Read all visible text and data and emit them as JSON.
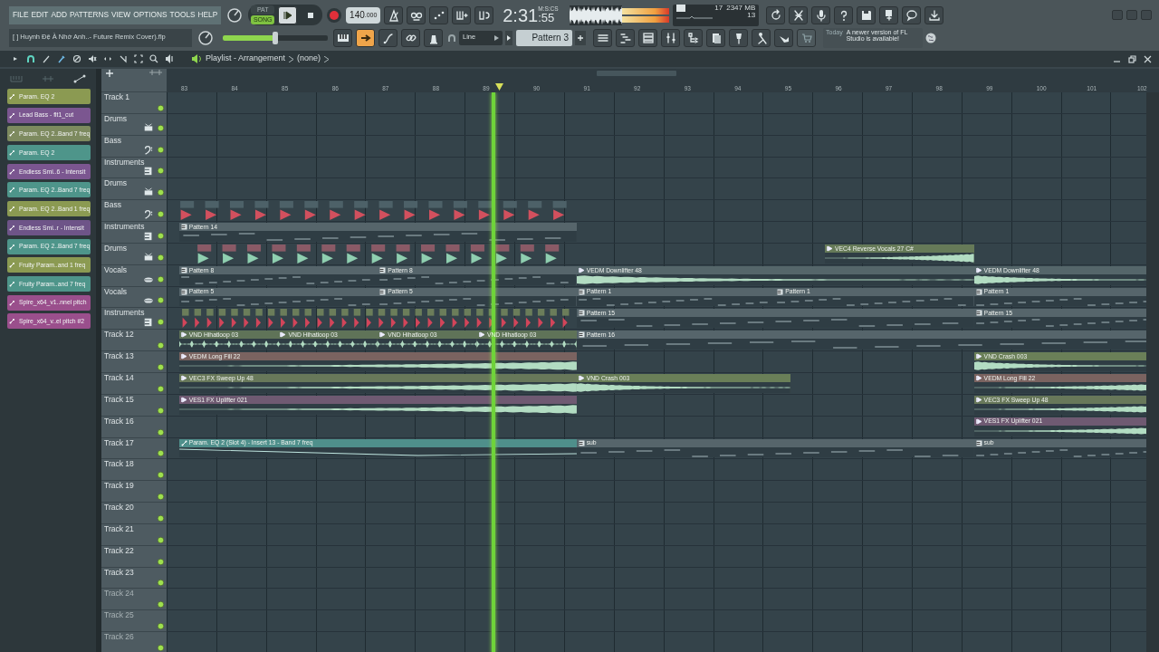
{
  "menu": [
    "FILE",
    "EDIT",
    "ADD",
    "PATTERNS",
    "VIEW",
    "OPTIONS",
    "TOOLS",
    "HELP"
  ],
  "file_name": "[    ] Huynh Đệ À Nhớ Anh..- Future Remix Cover).flp",
  "mode": [
    {
      "label": "PAT",
      "selected": false
    },
    {
      "label": "SONG",
      "selected": true
    }
  ],
  "tempo": {
    "whole": "140",
    "fraction": ".000"
  },
  "master_volume": {
    "level": 0.5
  },
  "time": {
    "value": "2:31",
    "centis": ":55",
    "units": "M:S:CS"
  },
  "cpu": {
    "value": "17"
  },
  "memory": {
    "value": "2347 MB"
  },
  "polyphony": {
    "value": "13"
  },
  "edit_tools": [
    {
      "selected": false
    },
    {
      "selected": true
    },
    {
      "selected": false
    },
    {
      "selected": false
    },
    {
      "selected": false
    }
  ],
  "snap": {
    "value": "Line"
  },
  "pattern": {
    "value": "Pattern 3"
  },
  "news": {
    "date": "Today",
    "message": "A newer version of FL Studio is available!"
  },
  "playlist": {
    "title": "Playlist - Arrangement",
    "context": "(none)"
  },
  "automation_clips": [
    {
      "label": "Param. EQ 2",
      "color": "#8b9a52"
    },
    {
      "label": "Lead Bass - flt1_cut",
      "color": "#7b5690"
    },
    {
      "label": "Param. EQ 2..Band 7 freq",
      "color": "#7d8a5f"
    },
    {
      "label": "Param. EQ 2",
      "color": "#4e958a"
    },
    {
      "label": "Endless Smi..6 - Intensit",
      "color": "#7b5690"
    },
    {
      "label": "Param. EQ 2..Band 7 freq",
      "color": "#4e958a"
    },
    {
      "label": "Param. EQ 2..Band 1 freq",
      "color": "#8b9a52"
    },
    {
      "label": "Endless Smi..r - Intensit",
      "color": "#6e5488"
    },
    {
      "label": "Param. EQ 2..Band 7 freq",
      "color": "#4e958a"
    },
    {
      "label": "Fruity Param..and 1 freq",
      "color": "#8b9a52"
    },
    {
      "label": "Fruity Param..and 7 freq",
      "color": "#4e958a"
    },
    {
      "label": "Spire_x64_v1..nnel pitch",
      "color": "#9a4f8c"
    },
    {
      "label": "Spire_x64_v..el pitch #2",
      "color": "#9a4f8c"
    }
  ],
  "ruler": [
    "83",
    "84",
    "85",
    "86",
    "87",
    "88",
    "89",
    "90",
    "91",
    "92",
    "93",
    "94",
    "95",
    "96",
    "97",
    "98",
    "99",
    "100",
    "101",
    "102"
  ],
  "tracks": [
    {
      "name": "Track 1",
      "kind": "plain",
      "dimmed": false
    },
    {
      "name": "Drums",
      "kind": "drums",
      "dimmed": false
    },
    {
      "name": "Bass",
      "kind": "bass",
      "dimmed": false
    },
    {
      "name": "Instruments",
      "kind": "instruments",
      "dimmed": false
    },
    {
      "name": "Drums",
      "kind": "drums",
      "dimmed": false
    },
    {
      "name": "Bass",
      "kind": "bass",
      "dimmed": false,
      "clips": [
        {
          "kind": "hits",
          "color": "#4d6168"
        }
      ]
    },
    {
      "name": "Instruments",
      "kind": "instruments",
      "dimmed": false,
      "clips": [
        {
          "kind": "pattern",
          "label": "Pattern 14",
          "color": "#56656b"
        }
      ]
    },
    {
      "name": "Drums",
      "kind": "drums",
      "dimmed": false,
      "clips": [
        {
          "kind": "hits",
          "color": "#8a5a66"
        },
        {
          "kind": "audio",
          "label": "VEC4 Reverse Vocals 27 C#",
          "color": "#667a58"
        }
      ]
    },
    {
      "name": "Vocals",
      "kind": "vocals",
      "dimmed": false,
      "clips": [
        {
          "kind": "pattern",
          "label": "Pattern 8",
          "color": "#56656b"
        },
        {
          "kind": "pattern",
          "label": "Pattern 8",
          "color": "#56656b"
        },
        {
          "kind": "audio",
          "label": "VEDM Downlifter 48",
          "color": "#55666a"
        },
        {
          "kind": "audio",
          "label": "VEDM Downlifter 48",
          "color": "#55666a"
        }
      ]
    },
    {
      "name": "Vocals",
      "kind": "vocals",
      "dimmed": false,
      "clips": [
        {
          "kind": "pattern",
          "label": "Pattern 5",
          "color": "#56656b"
        },
        {
          "kind": "pattern",
          "label": "Pattern 5",
          "color": "#56656b"
        },
        {
          "kind": "pattern",
          "label": "Pattern 1",
          "color": "#56656b"
        },
        {
          "kind": "pattern",
          "label": "Pattern 1",
          "color": "#56656b"
        },
        {
          "kind": "pattern",
          "label": "Pattern 1",
          "color": "#56656b"
        }
      ]
    },
    {
      "name": "Instruments",
      "kind": "instruments",
      "dimmed": false,
      "clips": [
        {
          "kind": "hits",
          "color": "#6b7d5a"
        },
        {
          "kind": "pattern",
          "label": "Pattern 15",
          "color": "#56656b"
        },
        {
          "kind": "pattern",
          "label": "Pattern 15",
          "color": "#56656b"
        }
      ]
    },
    {
      "name": "Track 12",
      "kind": "plain",
      "dimmed": false,
      "clips": [
        {
          "kind": "audio",
          "label": "VND Hihatloop 03",
          "color": "#5f7358"
        },
        {
          "kind": "audio",
          "label": "VND Hihatloop 03",
          "color": "#5f7358"
        },
        {
          "kind": "audio",
          "label": "VND Hihatloop 03",
          "color": "#5f7358"
        },
        {
          "kind": "audio",
          "label": "VND Hihatloop 03",
          "color": "#5f7358"
        },
        {
          "kind": "pattern",
          "label": "Pattern 16",
          "color": "#56656b"
        }
      ]
    },
    {
      "name": "Track 13",
      "kind": "plain",
      "dimmed": false,
      "clips": [
        {
          "kind": "audio",
          "label": "VEDM Long Fill 22",
          "color": "#7a6360"
        },
        {
          "kind": "audio",
          "label": "VND Crash 003",
          "color": "#6a7f58"
        }
      ]
    },
    {
      "name": "Track 14",
      "kind": "plain",
      "dimmed": false,
      "clips": [
        {
          "kind": "audio",
          "label": "VEC3 FX Sweep Up 48",
          "color": "#68785a"
        },
        {
          "kind": "audio",
          "label": "VND Crash 003",
          "color": "#6a7f58"
        },
        {
          "kind": "audio",
          "label": "VEDM Long Fill 22",
          "color": "#7a6360"
        }
      ]
    },
    {
      "name": "Track 15",
      "kind": "plain",
      "dimmed": false,
      "clips": [
        {
          "kind": "audio",
          "label": "VES1 FX Uplifter 021",
          "color": "#6f5a72"
        },
        {
          "kind": "audio",
          "label": "VEC3 FX Sweep Up 48",
          "color": "#68785a"
        }
      ]
    },
    {
      "name": "Track 16",
      "kind": "plain",
      "dimmed": false,
      "clips": [
        {
          "kind": "audio",
          "label": "VES1 FX Uplifter 021",
          "color": "#6f5a72"
        }
      ]
    },
    {
      "name": "Track 17",
      "kind": "plain",
      "dimmed": false,
      "clips": [
        {
          "kind": "automation",
          "label": "Param. EQ 2 (Slot 4) - Insert 13 - Band 7 freq",
          "color": "#4f8f8b"
        },
        {
          "kind": "pattern",
          "label": "sub",
          "color": "#56656b"
        },
        {
          "kind": "pattern",
          "label": "sub",
          "color": "#56656b"
        }
      ]
    },
    {
      "name": "Track 18",
      "kind": "plain",
      "dimmed": false
    },
    {
      "name": "Track 19",
      "kind": "plain",
      "dimmed": false
    },
    {
      "name": "Track 20",
      "kind": "plain",
      "dimmed": false
    },
    {
      "name": "Track 21",
      "kind": "plain",
      "dimmed": false
    },
    {
      "name": "Track 22",
      "kind": "plain",
      "dimmed": false
    },
    {
      "name": "Track 23",
      "kind": "plain",
      "dimmed": false
    },
    {
      "name": "Track 24",
      "kind": "plain",
      "dimmed": true
    },
    {
      "name": "Track 25",
      "kind": "plain",
      "dimmed": true
    },
    {
      "name": "Track 26",
      "kind": "plain",
      "dimmed": true
    }
  ]
}
